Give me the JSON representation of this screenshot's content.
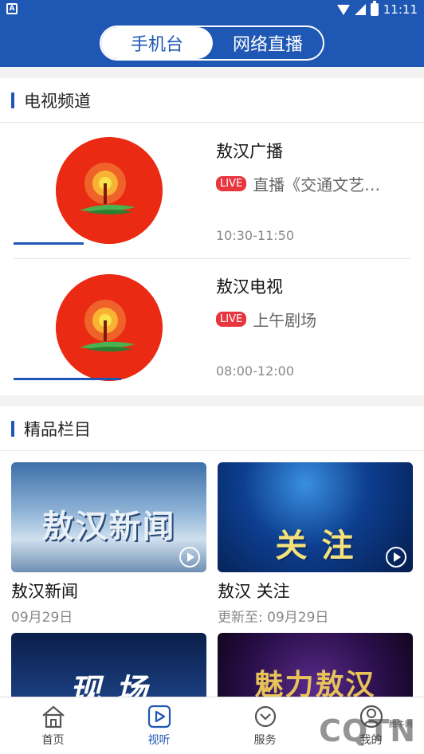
{
  "status_bar": {
    "time": "11:11"
  },
  "header": {
    "tabs": [
      {
        "label": "手机台",
        "active": true
      },
      {
        "label": "网络直播",
        "active": false
      }
    ]
  },
  "tv_section": {
    "title": "电视频道",
    "channels": [
      {
        "name": "敖汉广播",
        "live": "LIVE",
        "program": "直播《交通文艺…",
        "time": "10:30-11:50"
      },
      {
        "name": "敖汉电视",
        "live": "LIVE",
        "program": "上午剧场",
        "time": "08:00-12:00"
      }
    ]
  },
  "featured_section": {
    "title": "精品栏目",
    "items": [
      {
        "name": "敖汉新闻",
        "sub": "09月29日",
        "thumb_text": "敖汉新闻"
      },
      {
        "name": "敖汉 关注",
        "sub": "更新至: 09月29日",
        "thumb_text": "关 注"
      },
      {
        "name": "",
        "sub": "",
        "thumb_text": "现 场"
      },
      {
        "name": "",
        "sub": "",
        "thumb_text": "魅力敖汉"
      }
    ]
  },
  "bottom_nav": {
    "items": [
      {
        "label": "首页",
        "icon": "home-icon",
        "active": false
      },
      {
        "label": "视听",
        "icon": "play-icon",
        "active": true
      },
      {
        "label": "服务",
        "icon": "service-icon",
        "active": false
      },
      {
        "label": "我的",
        "icon": "user-icon",
        "active": false
      }
    ]
  },
  "watermark": {
    "text": "CQTN",
    "small": "腾牛网"
  },
  "colors": {
    "primary": "#1f57b4",
    "live": "#e8363f",
    "logo_red": "#ea2a12"
  }
}
